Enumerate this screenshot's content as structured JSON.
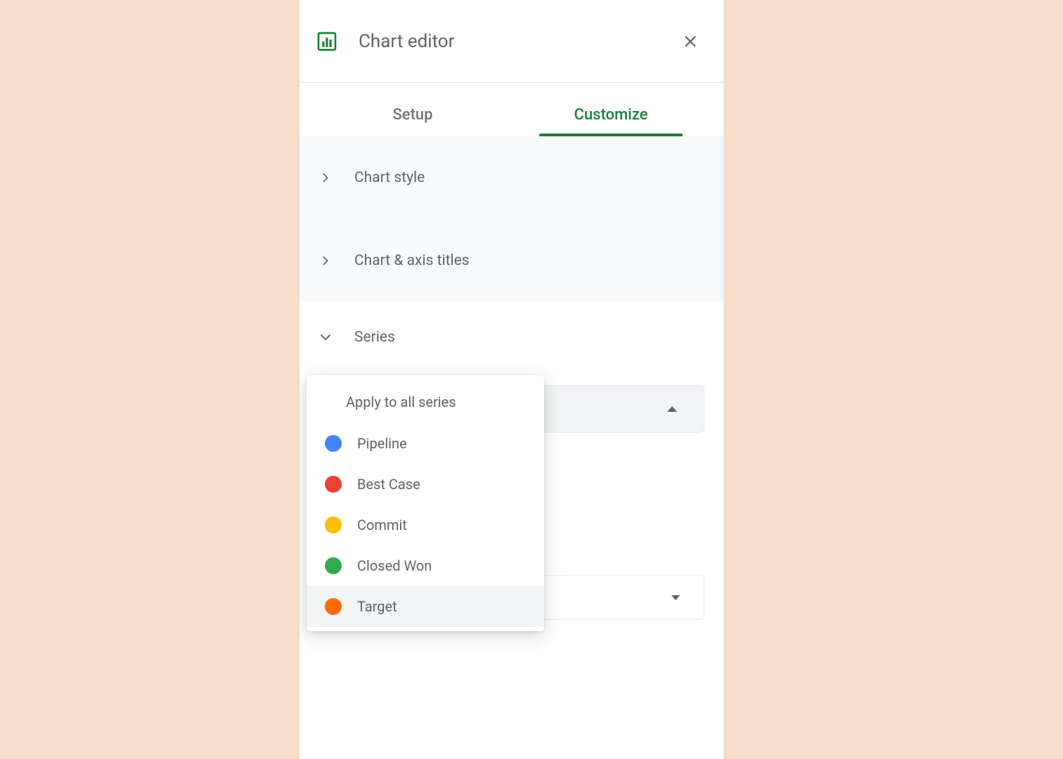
{
  "header": {
    "title": "Chart editor"
  },
  "tabs": {
    "setup": "Setup",
    "customize": "Customize"
  },
  "sections": {
    "chart_style": "Chart style",
    "chart_axis_titles": "Chart & axis titles",
    "series": "Series"
  },
  "series_dropdown": {
    "apply_all": "Apply to all series",
    "options": [
      {
        "label": "Pipeline",
        "color": "#4285f4"
      },
      {
        "label": "Best Case",
        "color": "#ea4335"
      },
      {
        "label": "Commit",
        "color": "#fbbc04"
      },
      {
        "label": "Closed Won",
        "color": "#34a853"
      },
      {
        "label": "Target",
        "color": "#ff6d01"
      }
    ]
  }
}
